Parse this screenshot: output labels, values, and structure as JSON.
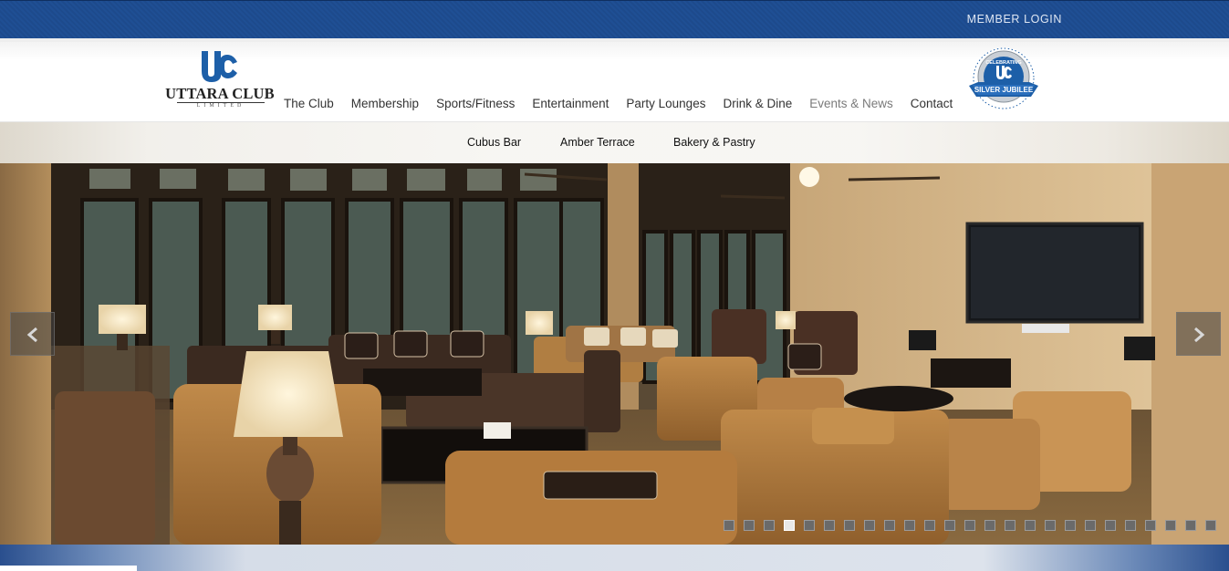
{
  "topbar": {
    "member_login": "MEMBER LOGIN"
  },
  "logo": {
    "name": "UTTARA CLUB",
    "sub": "LIMITED"
  },
  "nav": {
    "items": [
      {
        "label": "The Club"
      },
      {
        "label": "Membership"
      },
      {
        "label": "Sports/Fitness"
      },
      {
        "label": "Entertainment"
      },
      {
        "label": "Party Lounges"
      },
      {
        "label": "Drink & Dine"
      },
      {
        "label": "Events & News",
        "active": true
      },
      {
        "label": "Contact"
      }
    ]
  },
  "badge": {
    "top_text": "CELEBRATING",
    "ribbon": "SILVER JUBILEE"
  },
  "submenu": {
    "items": [
      "Cubus Bar",
      "Amber Terrace",
      "Bakery & Pastry"
    ]
  },
  "slider": {
    "dot_count": 25,
    "active_index": 3
  },
  "colors": {
    "topbar": "#1f4f94",
    "brand_blue": "#1d5fa8",
    "text": "#333333",
    "active_nav": "#7a7a7a"
  },
  "icons": [
    "chevron-left-icon",
    "chevron-right-icon"
  ]
}
